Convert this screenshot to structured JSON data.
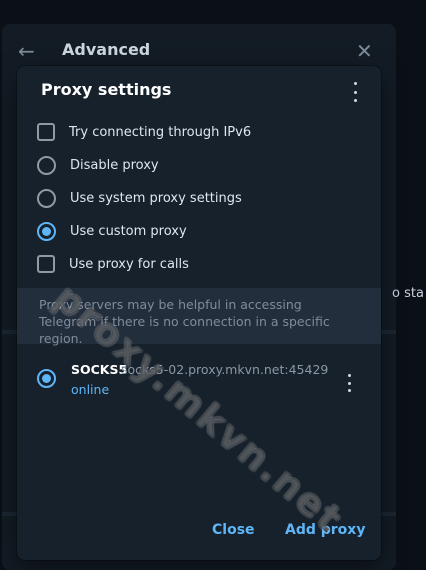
{
  "background": {
    "title": "Advanced",
    "back_icon": "arrow-left-icon",
    "close_icon": "close-icon",
    "side_text": "o sta"
  },
  "modal": {
    "title": "Proxy settings",
    "menu_icon": "more-vertical-icon",
    "options": [
      {
        "label": "Try connecting through IPv6",
        "control": "checkbox",
        "checked": false
      },
      {
        "label": "Disable proxy",
        "control": "radio",
        "checked": false
      },
      {
        "label": "Use system proxy settings",
        "control": "radio",
        "checked": false
      },
      {
        "label": "Use custom proxy",
        "control": "radio",
        "checked": true
      },
      {
        "label": "Use proxy for calls",
        "control": "checkbox",
        "checked": false
      }
    ],
    "info_text": "Proxy servers may be helpful in accessing Telegram if there is no connection in a specific region.",
    "proxy": {
      "type": "SOCKS5",
      "host": "socks5-02.proxy.mkvn.net:45429",
      "status": "online",
      "selected": true
    },
    "buttons": {
      "close": "Close",
      "add": "Add proxy"
    }
  },
  "watermark": "proxy.mkvn.net",
  "colors": {
    "accent": "#5eb5f7",
    "modal_bg": "#17212b",
    "info_bg": "#232e3c"
  }
}
